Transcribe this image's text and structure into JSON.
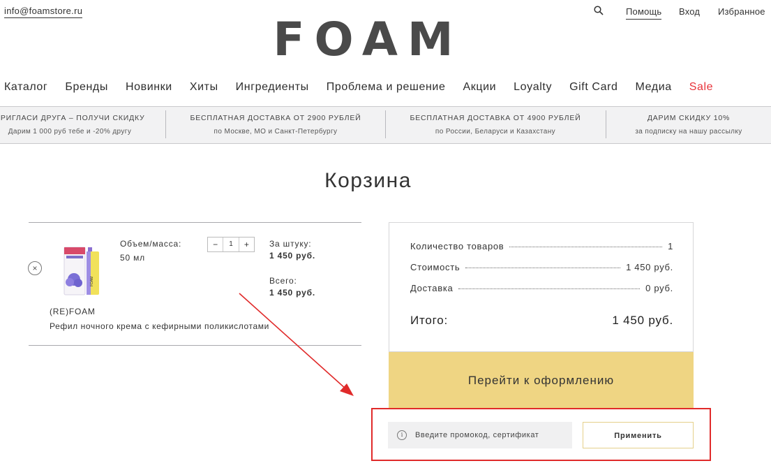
{
  "header": {
    "email": "info@foamstore.ru",
    "links": [
      "Помощь",
      "Вход",
      "Избранное"
    ],
    "search_icon": "search-icon"
  },
  "logo": {
    "text": "FOAM"
  },
  "nav": {
    "items": [
      "Каталог",
      "Бренды",
      "Новинки",
      "Хиты",
      "Ингредиенты",
      "Проблема и решение",
      "Акции",
      "Loyalty",
      "Gift Card",
      "Медиа",
      "Sale"
    ],
    "sale_color": "#e8333a"
  },
  "promo_strip": [
    {
      "title": "ПРИГЛАСИ ДРУГА – ПОЛУЧИ СКИДКУ",
      "sub": "Дарим 1 000 руб тебе и -20% другу"
    },
    {
      "title": "БЕСПЛАТНАЯ ДОСТАВКА ОТ 2900 РУБЛЕЙ",
      "sub": "по Москве, МО и Санкт-Петербургу"
    },
    {
      "title": "БЕСПЛАТНАЯ ДОСТАВКА ОТ 4900 РУБЛЕЙ",
      "sub": "по России, Беларуси и Казахстану"
    },
    {
      "title": "ДАРИМ СКИДКУ 10%",
      "sub": "за подписку на нашу рассылку"
    }
  ],
  "page": {
    "title": "Корзина"
  },
  "cart_item": {
    "remove_icon": "×",
    "volume_label": "Объем/масса:",
    "volume_value": "50 мл",
    "qty_minus": "−",
    "qty_value": "1",
    "qty_plus": "+",
    "unit_label": "За штуку:",
    "unit_price": "1 450 руб.",
    "total_label": "Всего:",
    "total_price": "1 450 руб.",
    "brand": "(RE)FOAM",
    "name": "Рефил ночного крема с кефирными поликислотами"
  },
  "summary": {
    "qty_label": "Количество товаров",
    "qty_value": "1",
    "cost_label": "Стоимость",
    "cost_value": "1 450 руб.",
    "delivery_label": "Доставка",
    "delivery_value": "0 руб.",
    "total_label": "Итого:",
    "total_value": "1 450 руб.",
    "checkout_label": "Перейти к оформлению",
    "checkout_color": "#efd583"
  },
  "promo_form": {
    "info_icon": "i",
    "placeholder": "Введите промокод, сертификат",
    "apply_label": "Применить"
  },
  "annotation": {
    "color": "#e02a2a"
  }
}
